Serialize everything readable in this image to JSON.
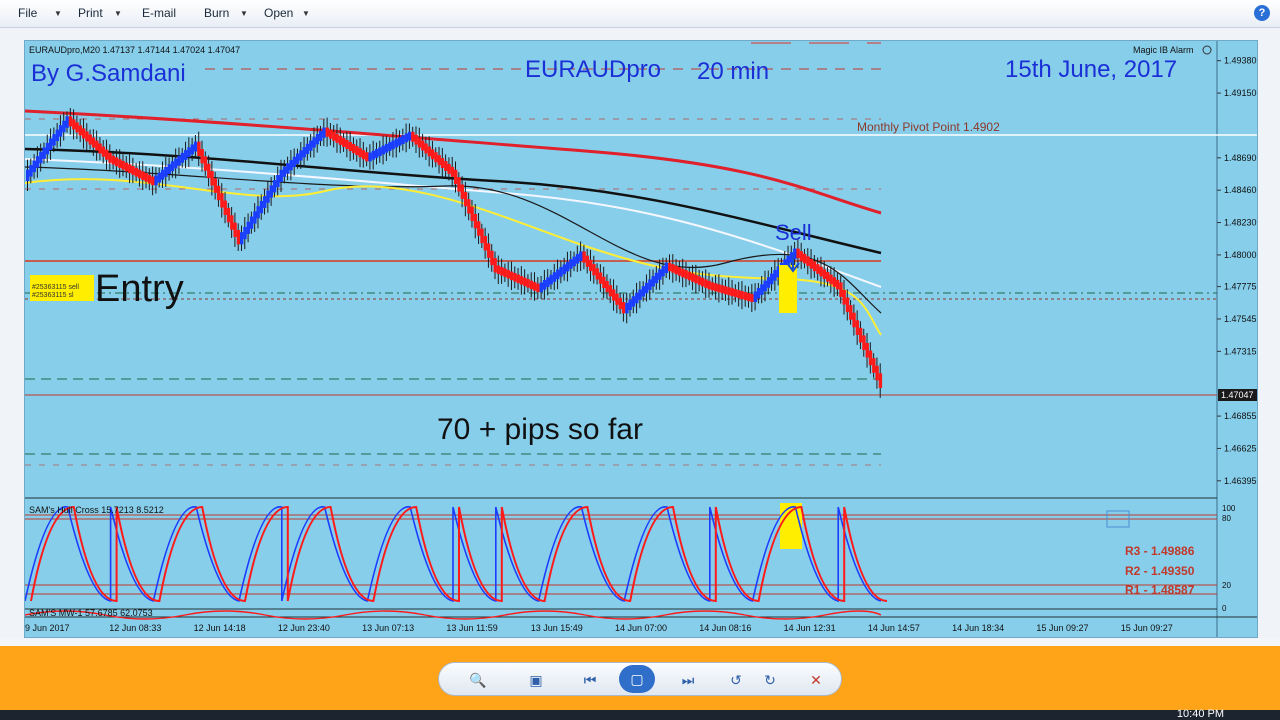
{
  "menu": {
    "file": "File",
    "print": "Print",
    "email": "E-mail",
    "burn": "Burn",
    "open": "Open"
  },
  "chart": {
    "header": "EURAUDpro,M20  1.47137 1.47144 1.47024 1.47047",
    "alarm": "Magic IB Alarm",
    "author": "By G.Samdani",
    "title_symbol": "EURAUDpro",
    "title_tf": "20 min",
    "date": "15th June, 2017",
    "pivot_label": "Monthly Pivot Point  1.4902",
    "sell_label": "Sell",
    "entry_label": "Entry",
    "entry_tag_1": "#25363115 sell",
    "entry_tag_2": "#25363115 sl",
    "pips_label": "70 + pips so far",
    "bid_label": "1.47047",
    "osc_label": "SAM's Hull Cross 15.7213 8.5212",
    "osc2_label": "SAM'S MW-1 57.6785 62.0753",
    "r3": "R3 - 1.49886",
    "r2": "R2 - 1.49350",
    "r1": "R1 - 1.48587"
  },
  "colors": {
    "bg": "#87ceeb",
    "bull": "#1a3dff",
    "bear": "#ff1a1a",
    "accent": "#ffa319"
  },
  "chart_data": {
    "type": "candlestick",
    "title": "EURAUDpro  20 min",
    "y_ticks": [
      "1.49380",
      "1.49150",
      "1.48690",
      "1.48460",
      "1.48230",
      "1.48000",
      "1.47775",
      "1.47545",
      "1.47315",
      "1.46855",
      "1.46625",
      "1.46395"
    ],
    "x_ticks": [
      "9 Jun 2017",
      "12 Jun 08:33",
      "12 Jun 14:18",
      "12 Jun 23:40",
      "13 Jun 07:13",
      "13 Jun 11:59",
      "13 Jun 15:49",
      "14 Jun 07:00",
      "14 Jun 08:16",
      "14 Jun 12:31",
      "14 Jun 14:57",
      "14 Jun 18:34",
      "15 Jun 09:27",
      "15 Jun 09:27"
    ],
    "osc_ticks": [
      "100",
      "80",
      "20",
      "0"
    ],
    "price_path": [
      1.4855,
      1.4896,
      1.4868,
      1.4852,
      1.4878,
      1.481,
      1.4858,
      1.4888,
      1.4869,
      1.4885,
      1.4858,
      1.479,
      1.4776,
      1.48,
      1.4761,
      1.4792,
      1.4778,
      1.4769,
      1.4802,
      1.4778,
      1.4708
    ],
    "pivot": 1.4902,
    "ylim": [
      1.4628,
      1.4952
    ]
  },
  "controls": {
    "zoom": "zoom",
    "fit": "fit",
    "prev": "previous",
    "slideshow": "slideshow",
    "next": "next",
    "rotate_left": "rotate-left",
    "rotate_right": "rotate-right",
    "close": "close"
  },
  "taskbar": {
    "time": "10:40 PM"
  }
}
